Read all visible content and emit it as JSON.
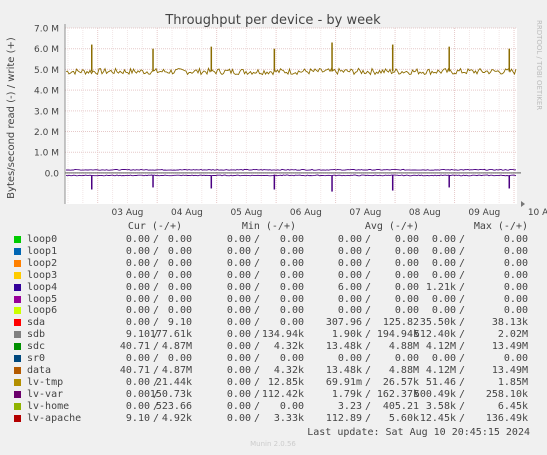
{
  "chart_data": {
    "type": "line",
    "title": "Throughput per device - by week",
    "ylabel": "Bytes/second read (-) / write (+)",
    "side_label": "RRDTOOL / TOBI OETIKER",
    "footer": "Munin 2.0.56",
    "y_ticks": [
      "7.0 M",
      "6.0 M",
      "5.0 M",
      "4.0 M",
      "3.0 M",
      "2.0 M",
      "1.0 M",
      "0.0"
    ],
    "y_tick_values": [
      7000000,
      6000000,
      5000000,
      4000000,
      3000000,
      2000000,
      1000000,
      0
    ],
    "ylim": [
      -1500000,
      7000000
    ],
    "x_ticks": [
      "03 Aug",
      "04 Aug",
      "05 Aug",
      "06 Aug",
      "07 Aug",
      "08 Aug",
      "09 Aug",
      "10 Aug"
    ],
    "x_range_days": [
      2.45,
      10.05
    ],
    "grid": true,
    "series": [
      {
        "name": "lv-tmp",
        "color": "#8c6c00",
        "write_level": 4900000,
        "read_level": 0,
        "spikes": [
          [
            2.9,
            6200000
          ],
          [
            3.93,
            6000000
          ],
          [
            4.91,
            6100000
          ],
          [
            5.97,
            6000000
          ],
          [
            6.94,
            6300000
          ],
          [
            7.96,
            6200000
          ],
          [
            8.91,
            6100000
          ],
          [
            9.92,
            6000000
          ]
        ]
      },
      {
        "name": "lv-var",
        "color": "#4b0082",
        "write_level": 150000,
        "read_level": -120000,
        "spikes": [
          [
            2.9,
            -800000
          ],
          [
            3.93,
            -700000
          ],
          [
            4.91,
            -750000
          ],
          [
            5.97,
            -800000
          ],
          [
            6.94,
            -900000
          ],
          [
            7.96,
            -850000
          ],
          [
            8.91,
            -700000
          ],
          [
            9.92,
            -750000
          ]
        ]
      }
    ],
    "legend_headers": [
      "Cur (-/+)",
      "Min (-/+)",
      "Avg (-/+)",
      "Max (-/+)"
    ],
    "legend": [
      {
        "name": "loop0",
        "color": "#00cc00",
        "cur": [
          "0.00",
          "0.00"
        ],
        "min": [
          "0.00",
          "0.00"
        ],
        "avg": [
          "0.00",
          "0.00"
        ],
        "max": [
          "0.00",
          "0.00"
        ]
      },
      {
        "name": "loop1",
        "color": "#0066b3",
        "cur": [
          "0.00",
          "0.00"
        ],
        "min": [
          "0.00",
          "0.00"
        ],
        "avg": [
          "0.00",
          "0.00"
        ],
        "max": [
          "0.00",
          "0.00"
        ]
      },
      {
        "name": "loop2",
        "color": "#ff8000",
        "cur": [
          "0.00",
          "0.00"
        ],
        "min": [
          "0.00",
          "0.00"
        ],
        "avg": [
          "0.00",
          "0.00"
        ],
        "max": [
          "0.00",
          "0.00"
        ]
      },
      {
        "name": "loop3",
        "color": "#ffcc00",
        "cur": [
          "0.00",
          "0.00"
        ],
        "min": [
          "0.00",
          "0.00"
        ],
        "avg": [
          "0.00",
          "0.00"
        ],
        "max": [
          "0.00",
          "0.00"
        ]
      },
      {
        "name": "loop4",
        "color": "#330099",
        "cur": [
          "0.00",
          "0.00"
        ],
        "min": [
          "0.00",
          "0.00"
        ],
        "avg": [
          "6.00",
          "0.00"
        ],
        "max": [
          "1.21k",
          "0.00"
        ]
      },
      {
        "name": "loop5",
        "color": "#990099",
        "cur": [
          "0.00",
          "0.00"
        ],
        "min": [
          "0.00",
          "0.00"
        ],
        "avg": [
          "0.00",
          "0.00"
        ],
        "max": [
          "0.00",
          "0.00"
        ]
      },
      {
        "name": "loop6",
        "color": "#ccff00",
        "cur": [
          "0.00",
          "0.00"
        ],
        "min": [
          "0.00",
          "0.00"
        ],
        "avg": [
          "0.00",
          "0.00"
        ],
        "max": [
          "0.00",
          "0.00"
        ]
      },
      {
        "name": "sda",
        "color": "#ff0000",
        "cur": [
          "0.00",
          "9.10"
        ],
        "min": [
          "0.00",
          "0.00"
        ],
        "avg": [
          "307.96",
          "125.82"
        ],
        "max": [
          "35.50k",
          "38.13k"
        ]
      },
      {
        "name": "sdb",
        "color": "#808080",
        "cur": [
          "9.10",
          "177.61k"
        ],
        "min": [
          "0.00",
          "134.94k"
        ],
        "avg": [
          "1.90k",
          "194.94k"
        ],
        "max": [
          "512.40k",
          "2.02M"
        ]
      },
      {
        "name": "sdc",
        "color": "#008f00",
        "cur": [
          "40.71",
          "4.87M"
        ],
        "min": [
          "0.00",
          "4.32k"
        ],
        "avg": [
          "13.48k",
          "4.88M"
        ],
        "max": [
          "4.12M",
          "13.49M"
        ]
      },
      {
        "name": "sr0",
        "color": "#00487d",
        "cur": [
          "0.00",
          "0.00"
        ],
        "min": [
          "0.00",
          "0.00"
        ],
        "avg": [
          "0.00",
          "0.00"
        ],
        "max": [
          "0.00",
          "0.00"
        ]
      },
      {
        "name": "data",
        "color": "#b35a00",
        "cur": [
          "40.71",
          "4.87M"
        ],
        "min": [
          "0.00",
          "4.32k"
        ],
        "avg": [
          "13.48k",
          "4.88M"
        ],
        "max": [
          "4.12M",
          "13.49M"
        ]
      },
      {
        "name": "lv-tmp",
        "color": "#b38f00",
        "cur": [
          "0.00",
          "21.44k"
        ],
        "min": [
          "0.00",
          "12.85k"
        ],
        "avg": [
          "69.91m",
          "26.57k"
        ],
        "max": [
          "51.46",
          "1.85M"
        ]
      },
      {
        "name": "lv-var",
        "color": "#6b006b",
        "cur": [
          "0.00",
          "150.73k"
        ],
        "min": [
          "0.00",
          "112.42k"
        ],
        "avg": [
          "1.79k",
          "162.37k"
        ],
        "max": [
          "500.49k",
          "258.10k"
        ]
      },
      {
        "name": "lv-home",
        "color": "#8fb300",
        "cur": [
          "0.00",
          "523.66"
        ],
        "min": [
          "0.00",
          "0.00"
        ],
        "avg": [
          "3.23",
          "405.21"
        ],
        "max": [
          "3.58k",
          "6.45k"
        ]
      },
      {
        "name": "lv-apache",
        "color": "#b30000",
        "cur": [
          "9.10",
          "4.92k"
        ],
        "min": [
          "0.00",
          "3.33k"
        ],
        "avg": [
          "112.89",
          "5.60k"
        ],
        "max": [
          "12.45k",
          "136.49k"
        ]
      }
    ],
    "last_update": "Last update: Sat Aug 10 20:45:15 2024"
  }
}
